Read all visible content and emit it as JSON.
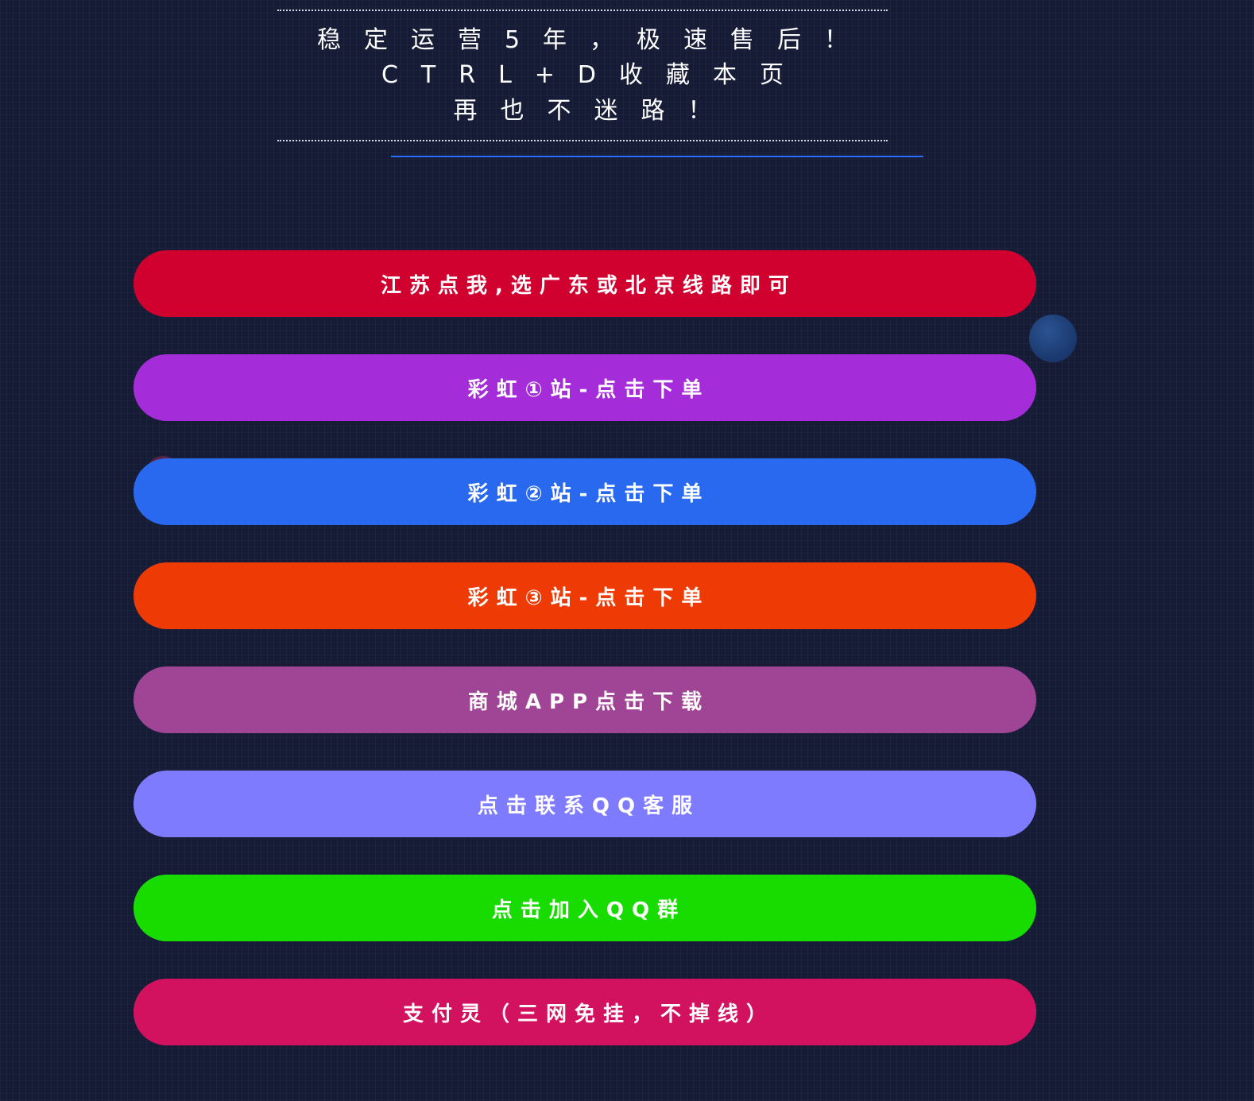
{
  "header": {
    "line1": "稳定运营5年，极速售后！",
    "line2": "CTRL+D收藏本页",
    "line3": "再也不迷路！"
  },
  "buttons": [
    {
      "label": "江苏点我,选广东或北京线路即可",
      "color": "#d0002f"
    },
    {
      "label": "彩虹①站-点击下单",
      "color": "#a52cd9"
    },
    {
      "label": "彩虹②站-点击下单",
      "color": "#2869f0"
    },
    {
      "label": "彩虹③站-点击下单",
      "color": "#ee3a05"
    },
    {
      "label": "商城APP点击下载",
      "color": "#a04495"
    },
    {
      "label": "点击联系QQ客服",
      "color": "#7f7bff"
    },
    {
      "label": "点击加入QQ群",
      "color": "#18dc00"
    },
    {
      "label": "支付灵（三网免挂，不掉线）",
      "color": "#d2125f"
    }
  ]
}
